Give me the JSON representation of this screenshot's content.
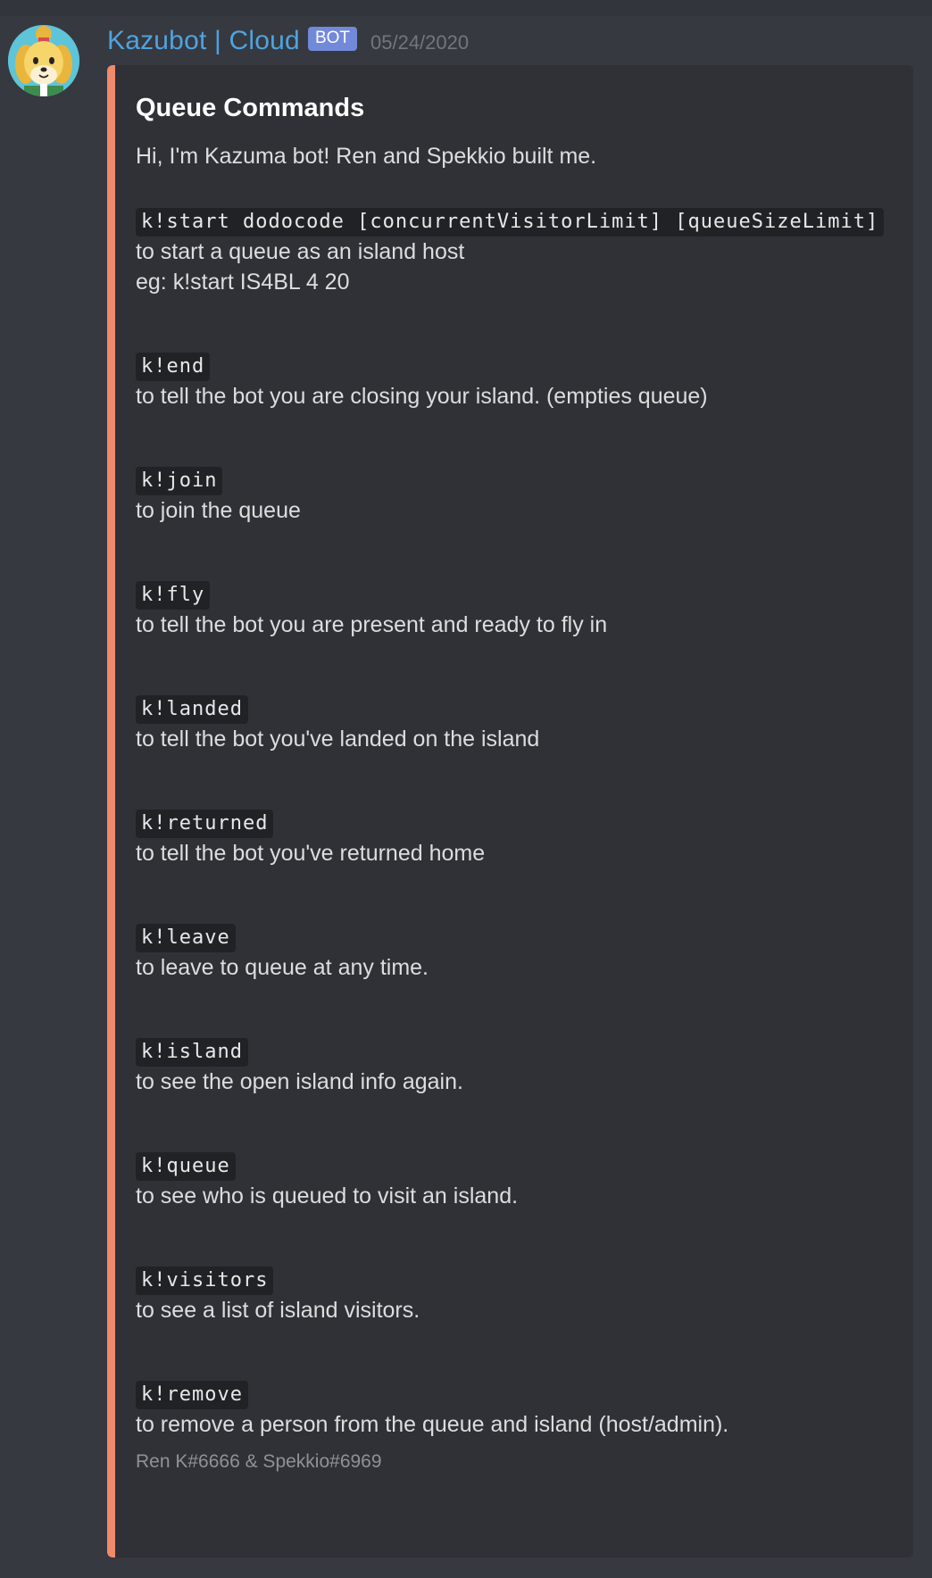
{
  "message": {
    "username": "Kazubot | Cloud",
    "bot_tag": "BOT",
    "timestamp": "05/24/2020",
    "avatar_icon": "villager-dog-avatar",
    "accent_color": "#f08a6c"
  },
  "embed": {
    "title": "Queue Commands",
    "intro": "Hi, I'm Kazuma bot! Ren and Spekkio built me.",
    "commands": [
      {
        "code": "k!start dodocode [concurrentVisitorLimit] [queueSizeLimit]",
        "lines": [
          "to start a queue as an island host",
          "eg: k!start IS4BL 4 20"
        ]
      },
      {
        "code": "k!end",
        "lines": [
          "to tell the bot you are closing your island. (empties queue)"
        ]
      },
      {
        "code": "k!join",
        "lines": [
          "to join the queue"
        ]
      },
      {
        "code": "k!fly",
        "lines": [
          "to tell the bot you are present and ready to fly in"
        ]
      },
      {
        "code": "k!landed",
        "lines": [
          "to tell the bot you've landed on the island"
        ]
      },
      {
        "code": "k!returned",
        "lines": [
          "to tell the bot you've returned home"
        ]
      },
      {
        "code": "k!leave",
        "lines": [
          "to leave to queue at any time."
        ]
      },
      {
        "code": "k!island",
        "lines": [
          "to see the open island info again."
        ]
      },
      {
        "code": "k!queue",
        "lines": [
          "to see who is queued to visit an island."
        ]
      },
      {
        "code": "k!visitors",
        "lines": [
          "to see a list of island visitors."
        ]
      },
      {
        "code": "k!remove",
        "lines": [
          "to remove a person from the queue and island (host/admin)."
        ]
      }
    ],
    "footer": "Ren K#6666 & Spekkio#6969"
  }
}
